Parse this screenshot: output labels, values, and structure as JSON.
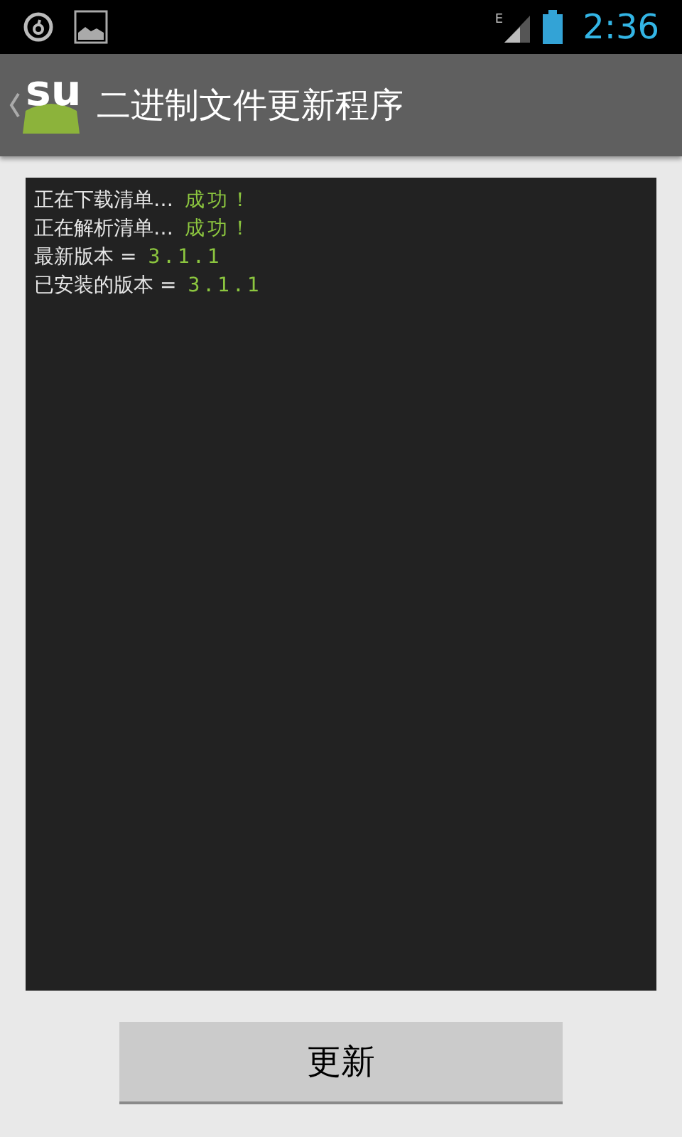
{
  "status_bar": {
    "time": "2:36",
    "network": "E"
  },
  "action_bar": {
    "logo": "su",
    "title": "二进制文件更新程序"
  },
  "console": [
    {
      "label": "正在下载清单…",
      "value": "成功！"
    },
    {
      "label": "正在解析清单…",
      "value": "成功！"
    },
    {
      "label": "最新版本 =",
      "value": "3.1.1"
    },
    {
      "label": "已安装的版本 =",
      "value": "3.1.1"
    }
  ],
  "button": {
    "label": "更新"
  }
}
